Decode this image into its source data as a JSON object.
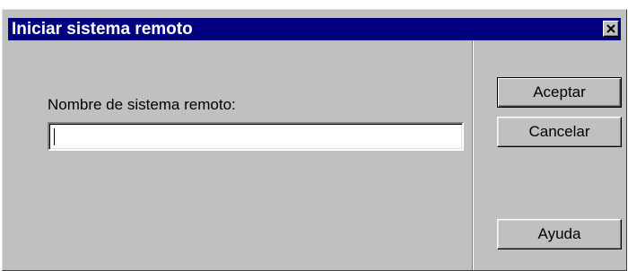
{
  "window": {
    "title": "Iniciar sistema remoto",
    "close_icon": "close-icon"
  },
  "form": {
    "label": "Nombre de sistema remoto:",
    "input_value": "",
    "input_placeholder": ""
  },
  "buttons": {
    "ok": "Aceptar",
    "cancel": "Cancelar",
    "help": "Ayuda"
  },
  "colors": {
    "title_bar": "#000080",
    "title_text": "#ffffff",
    "face": "#c0c0c0"
  }
}
